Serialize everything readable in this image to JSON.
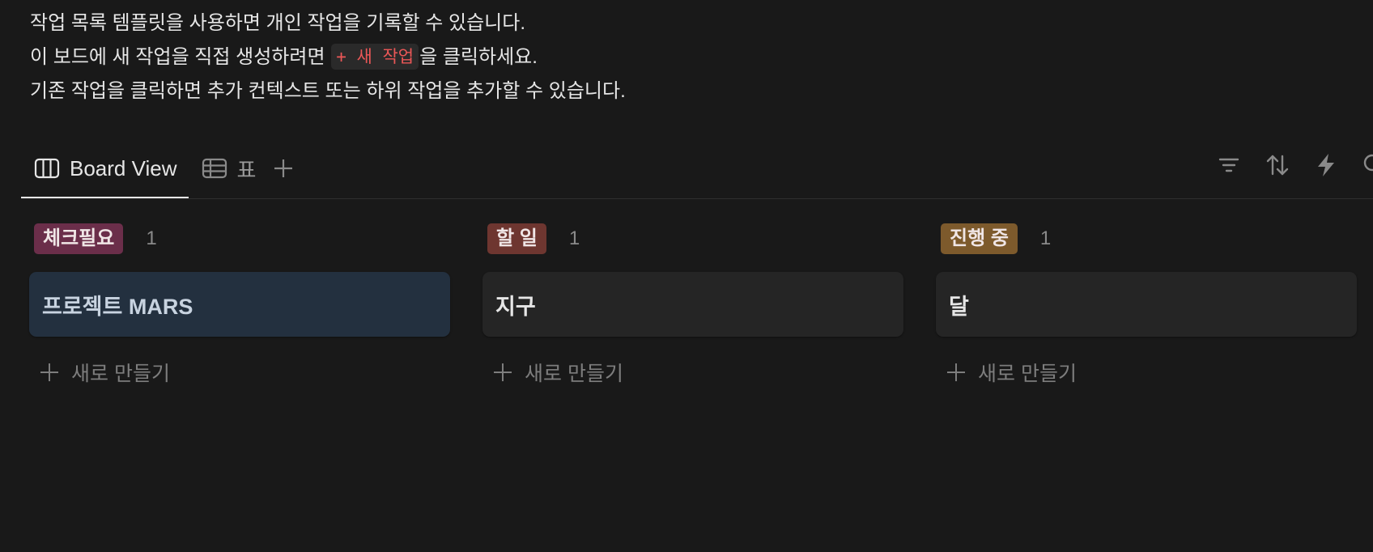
{
  "intro": {
    "line1": "작업 목록 템플릿을 사용하면 개인 작업을 기록할 수 있습니다.",
    "line2_before": "이 보드에 새 작업을 직접 생성하려면 ",
    "line2_code": "+ 새 작업",
    "line2_after": "을 클릭하세요.",
    "line3": "기존 작업을 클릭하면 추가 컨텍스트 또는 하위 작업을 추가할 수 있습니다."
  },
  "tabs": [
    {
      "label": "Board View",
      "icon": "board-icon",
      "active": true
    },
    {
      "label": "표",
      "icon": "table-icon",
      "active": false
    }
  ],
  "toolbar": {
    "icons": [
      "filter-icon",
      "sort-icon",
      "automation-icon",
      "search-icon"
    ]
  },
  "columns": [
    {
      "status": "체크필요",
      "count": "1",
      "color": "#6b2e4a",
      "cards": [
        {
          "title": "프로젝트 MARS",
          "selected": true
        }
      ],
      "new_label": "새로 만들기"
    },
    {
      "status": "할 일",
      "count": "1",
      "color": "#6e3630",
      "cards": [
        {
          "title": "지구",
          "selected": false
        }
      ],
      "new_label": "새로 만들기"
    },
    {
      "status": "진행 중",
      "count": "1",
      "color": "#7d5a2c",
      "cards": [
        {
          "title": "달",
          "selected": false
        }
      ],
      "new_label": "새로 만들기"
    }
  ]
}
